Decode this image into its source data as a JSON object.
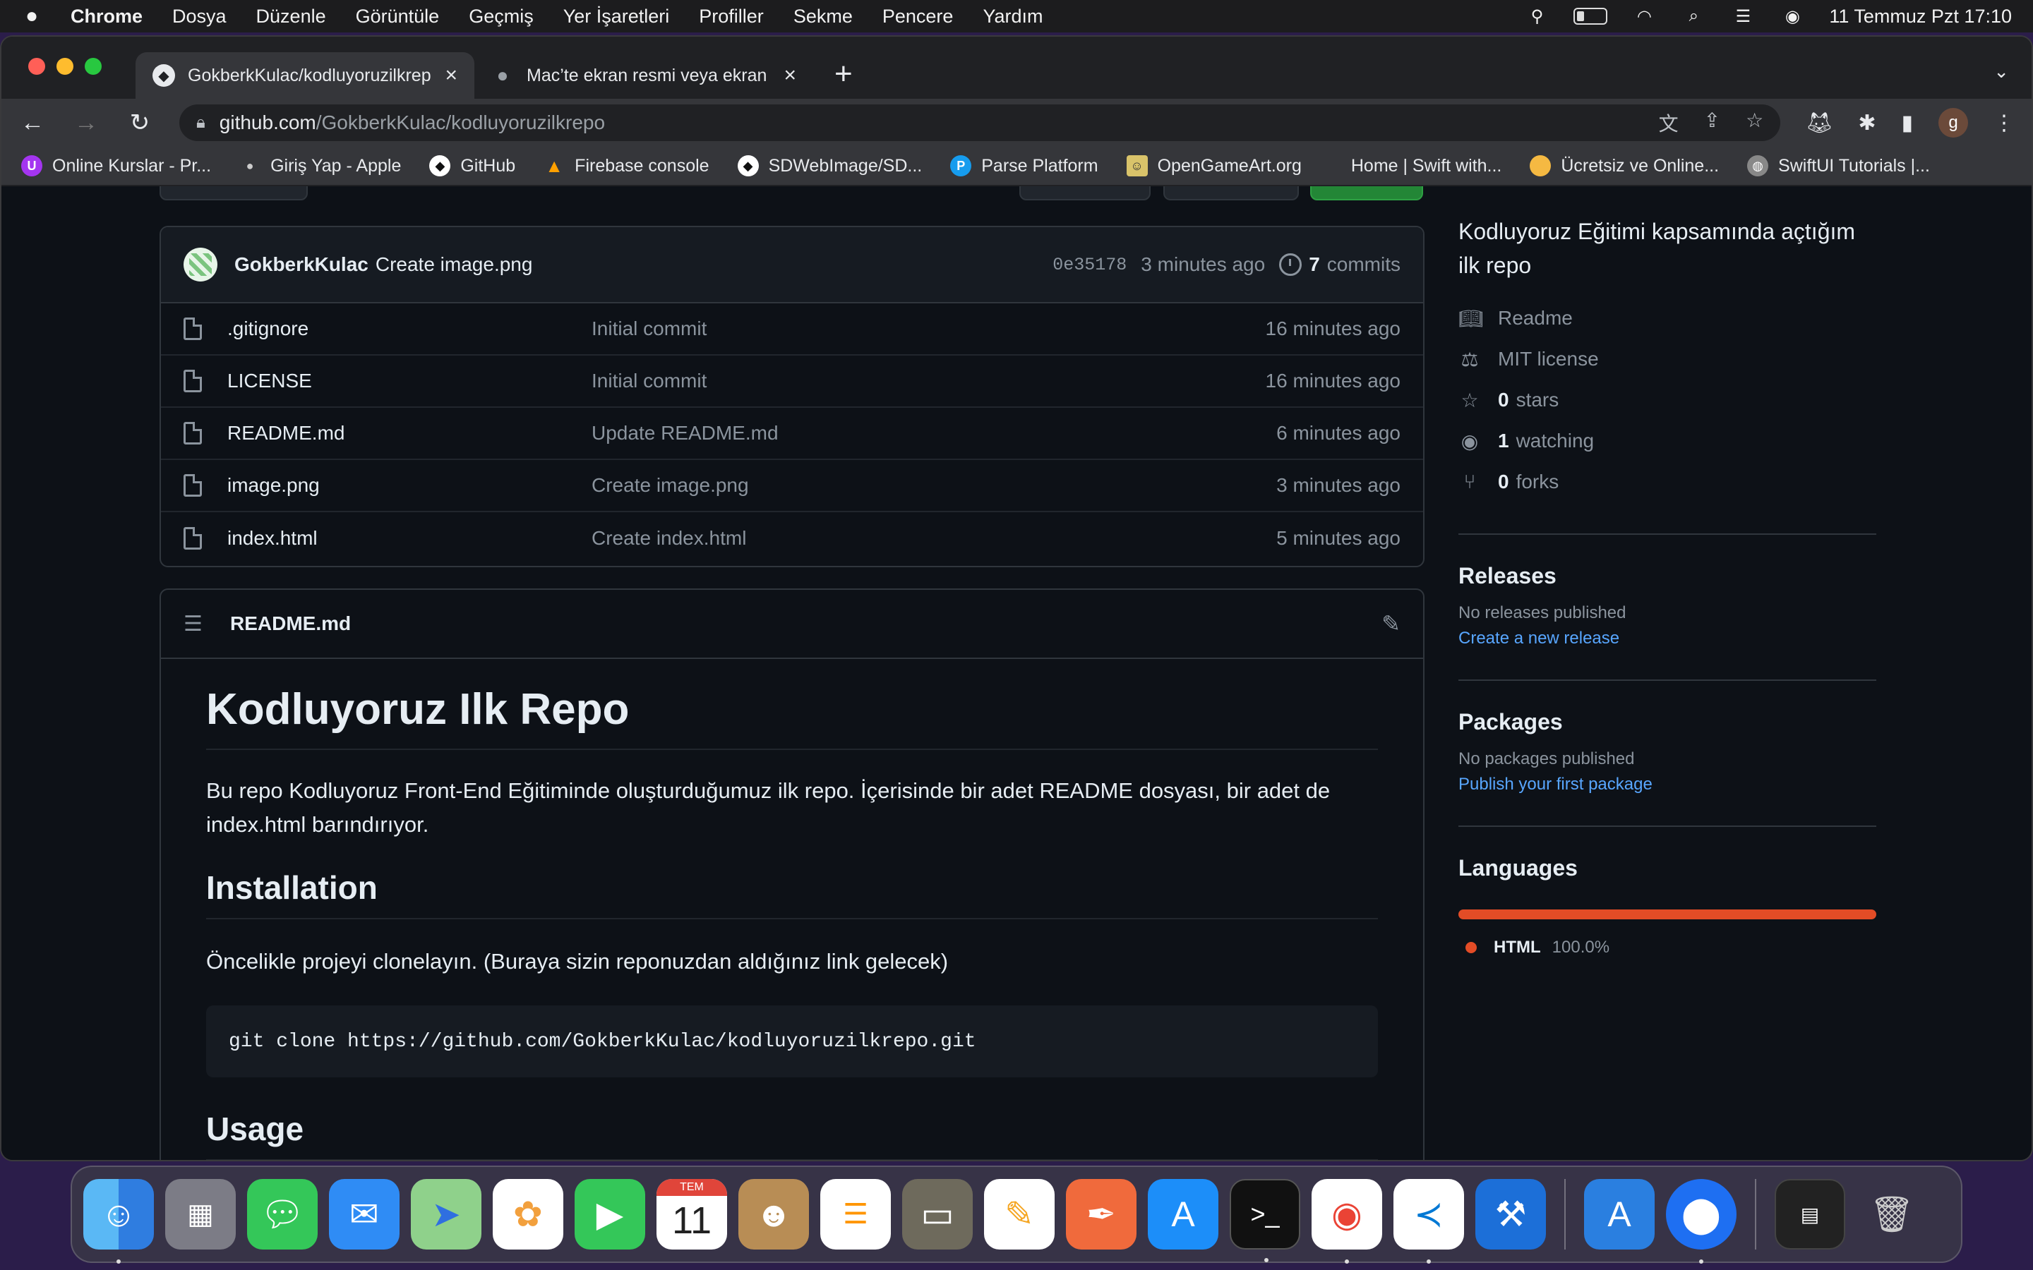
{
  "menubar": {
    "app": "Chrome",
    "items": [
      "Dosya",
      "Düzenle",
      "Görüntüle",
      "Geçmiş",
      "Yer İşaretleri",
      "Profiller",
      "Sekme",
      "Pencere",
      "Yardım"
    ],
    "datetime": "11 Temmuz Pzt  17:10"
  },
  "tabs": [
    {
      "title": "GokberkKulac/kodluyoruzilkrep",
      "favicon": "github-icon",
      "active": true
    },
    {
      "title": "Mac’te ekran resmi veya ekran",
      "favicon": "apple-icon",
      "active": false
    }
  ],
  "omnibox": {
    "host": "github.com",
    "path": "/GokberkKulac/kodluyoruzilkrepo"
  },
  "bookmarks": [
    {
      "label": "Online Kurslar - Pr...",
      "icon": "udemy-icon",
      "color": "#a435f0"
    },
    {
      "label": "Giriş Yap - Apple",
      "icon": "apple-icon",
      "color": "#333333"
    },
    {
      "label": "GitHub",
      "icon": "github-icon",
      "color": "#ffffff"
    },
    {
      "label": "Firebase console",
      "icon": "firebase-icon",
      "color": "#ffa000"
    },
    {
      "label": "SDWebImage/SD...",
      "icon": "github-icon",
      "color": "#ffffff"
    },
    {
      "label": "Parse Platform",
      "icon": "parse-icon",
      "color": "#169cee"
    },
    {
      "label": "OpenGameArt.org",
      "icon": "opengameart-icon",
      "color": "#d9c36a"
    },
    {
      "label": "Home | Swift with...",
      "icon": "",
      "color": ""
    },
    {
      "label": "Ücretsiz ve Online...",
      "icon": "coin-icon",
      "color": "#f5b942"
    },
    {
      "label": "SwiftUI Tutorials |...",
      "icon": "globe-icon",
      "color": "#888888"
    }
  ],
  "repo": {
    "last_commit": {
      "author": "GokberkKulac",
      "message": "Create image.png",
      "sha": "0e35178",
      "time": "3 minutes ago",
      "commits_count": "7",
      "commits_label": "commits"
    },
    "files": [
      {
        "name": ".gitignore",
        "message": "Initial commit",
        "time": "16 minutes ago"
      },
      {
        "name": "LICENSE",
        "message": "Initial commit",
        "time": "16 minutes ago"
      },
      {
        "name": "README.md",
        "message": "Update README.md",
        "time": "6 minutes ago"
      },
      {
        "name": "image.png",
        "message": "Create image.png",
        "time": "3 minutes ago"
      },
      {
        "name": "index.html",
        "message": "Create index.html",
        "time": "5 minutes ago"
      }
    ]
  },
  "readme": {
    "filename": "README.md",
    "h1": "Kodluyoruz Ilk Repo",
    "intro": "Bu repo Kodluyoruz Front-End Eğitiminde oluşturduğumuz ilk repo. İçerisinde bir adet README dosyası, bir adet de index.html barındırıyor.",
    "install_heading": "Installation",
    "install_text": "Öncelikle projeyi clonelayın. (Buraya sizin reponuzdan aldığınız link gelecek)",
    "clone_cmd": "git clone https://github.com/GokberkKulac/kodluyoruzilkrepo.git",
    "usage_heading": "Usage"
  },
  "about": {
    "description": "Kodluyoruz Eğitimi kapsamında açtığım ilk repo",
    "readme_label": "Readme",
    "license_label": "MIT license",
    "stars_count": "0",
    "stars_label": "stars",
    "watching_count": "1",
    "watching_label": "watching",
    "forks_count": "0",
    "forks_label": "forks"
  },
  "releases": {
    "heading": "Releases",
    "empty": "No releases published",
    "link": "Create a new release"
  },
  "packages": {
    "heading": "Packages",
    "empty": "No packages published",
    "link": "Publish your first package"
  },
  "languages": {
    "heading": "Languages",
    "items": [
      {
        "name": "HTML",
        "percent": "100.0%",
        "color": "#e34c26"
      }
    ]
  },
  "dock": {
    "calendar_month": "TEM",
    "calendar_day": "11"
  }
}
